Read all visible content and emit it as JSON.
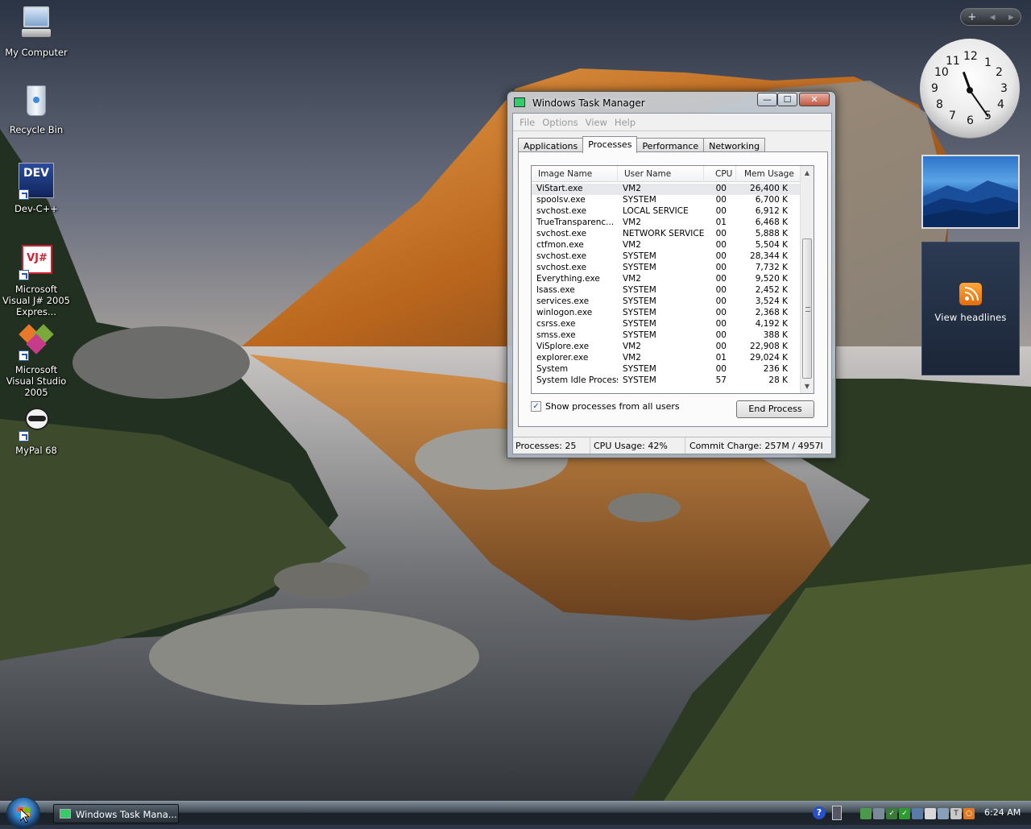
{
  "desktop": {
    "icons": [
      {
        "label": "My Computer"
      },
      {
        "label": "Recycle Bin"
      },
      {
        "label": "Dev-C++",
        "glyph_text": "DEV"
      },
      {
        "label": "Microsoft Visual J# 2005 Expres...",
        "glyph_text": "VJ#"
      },
      {
        "label": "Microsoft Visual Studio 2005"
      },
      {
        "label": "MyPal 68"
      }
    ]
  },
  "sidebar": {
    "controls": {
      "add": "+",
      "prev": "◂",
      "next": "▸"
    },
    "clock_numbers": [
      "12",
      "1",
      "2",
      "3",
      "4",
      "5",
      "6",
      "7",
      "8",
      "9",
      "10",
      "11"
    ],
    "feed_label": "View headlines"
  },
  "taskmgr": {
    "title": "Windows Task Manager",
    "buttons": {
      "minimize": "—",
      "maximize": "☐",
      "close": "✕"
    },
    "menu": [
      "File",
      "Options",
      "View",
      "Help"
    ],
    "tabs": [
      "Applications",
      "Processes",
      "Performance",
      "Networking"
    ],
    "active_tab": "Processes",
    "columns": [
      "Image Name",
      "User Name",
      "CPU",
      "Mem Usage"
    ],
    "processes": [
      {
        "name": "ViStart.exe",
        "user": "VM2",
        "cpu": "00",
        "mem": "26,400 K"
      },
      {
        "name": "spoolsv.exe",
        "user": "SYSTEM",
        "cpu": "00",
        "mem": "6,700 K"
      },
      {
        "name": "svchost.exe",
        "user": "LOCAL SERVICE",
        "cpu": "00",
        "mem": "6,912 K"
      },
      {
        "name": "TrueTransparenc...",
        "user": "VM2",
        "cpu": "01",
        "mem": "6,468 K"
      },
      {
        "name": "svchost.exe",
        "user": "NETWORK SERVICE",
        "cpu": "00",
        "mem": "5,888 K"
      },
      {
        "name": "ctfmon.exe",
        "user": "VM2",
        "cpu": "00",
        "mem": "5,504 K"
      },
      {
        "name": "svchost.exe",
        "user": "SYSTEM",
        "cpu": "00",
        "mem": "28,344 K"
      },
      {
        "name": "svchost.exe",
        "user": "SYSTEM",
        "cpu": "00",
        "mem": "7,732 K"
      },
      {
        "name": "Everything.exe",
        "user": "VM2",
        "cpu": "00",
        "mem": "9,520 K"
      },
      {
        "name": "lsass.exe",
        "user": "SYSTEM",
        "cpu": "00",
        "mem": "2,452 K"
      },
      {
        "name": "services.exe",
        "user": "SYSTEM",
        "cpu": "00",
        "mem": "3,524 K"
      },
      {
        "name": "winlogon.exe",
        "user": "SYSTEM",
        "cpu": "00",
        "mem": "2,368 K"
      },
      {
        "name": "csrss.exe",
        "user": "SYSTEM",
        "cpu": "00",
        "mem": "4,192 K"
      },
      {
        "name": "smss.exe",
        "user": "SYSTEM",
        "cpu": "00",
        "mem": "388 K"
      },
      {
        "name": "ViSplore.exe",
        "user": "VM2",
        "cpu": "00",
        "mem": "22,908 K"
      },
      {
        "name": "explorer.exe",
        "user": "VM2",
        "cpu": "01",
        "mem": "29,024 K"
      },
      {
        "name": "System",
        "user": "SYSTEM",
        "cpu": "00",
        "mem": "236 K"
      },
      {
        "name": "System Idle Process",
        "user": "SYSTEM",
        "cpu": "57",
        "mem": "28 K"
      }
    ],
    "show_all_label": "Show processes from all users",
    "show_all_checked": true,
    "end_process_label": "End Process",
    "status": {
      "processes": "Processes: 25",
      "cpu": "CPU Usage: 42%",
      "commit": "Commit Charge: 257M / 4957I"
    }
  },
  "taskbar": {
    "task_button_label": "Windows Task Mana...",
    "time": "6:24 AM",
    "help": "?"
  }
}
